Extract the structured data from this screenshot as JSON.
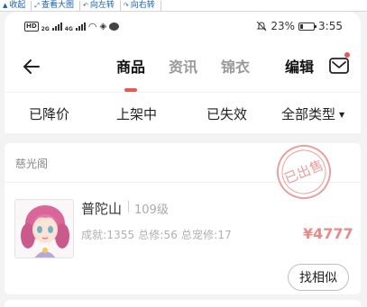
{
  "viewer_toolbar": {
    "items": [
      {
        "icon": "caret-up-icon",
        "label": "收起"
      },
      {
        "icon": "expand-icon",
        "label": "查看大图"
      },
      {
        "icon": "rotate-left-icon",
        "label": "向左转"
      },
      {
        "icon": "rotate-right-icon",
        "label": "向右转"
      }
    ]
  },
  "status_bar": {
    "hd_label": "HD",
    "signal_1_label": "2G",
    "signal_2_label": "4G",
    "battery_percent": "23%",
    "battery_level": 0.23,
    "time": "3:55"
  },
  "nav": {
    "tabs": [
      {
        "label": "商品",
        "active": true
      },
      {
        "label": "资讯",
        "active": false
      },
      {
        "label": "锦衣",
        "active": false
      }
    ],
    "edit_label": "编辑",
    "has_unread_mail": true
  },
  "filters": {
    "items": [
      {
        "label": "已降价"
      },
      {
        "label": "上架中"
      },
      {
        "label": "已失效"
      },
      {
        "label": "全部类型",
        "has_dropdown": true
      }
    ]
  },
  "listing": {
    "shop_name": "慈光阁",
    "stamp_text": "已出售",
    "item_name": "普陀山",
    "item_level": "109级",
    "item_stats": "成就:1355 总修:56 总宠修:17",
    "price": "¥4777",
    "find_similar_label": "找相似"
  },
  "colors": {
    "accent": "#e25b5b",
    "price": "#e88a8a",
    "stamp": "#e8a0a0"
  }
}
